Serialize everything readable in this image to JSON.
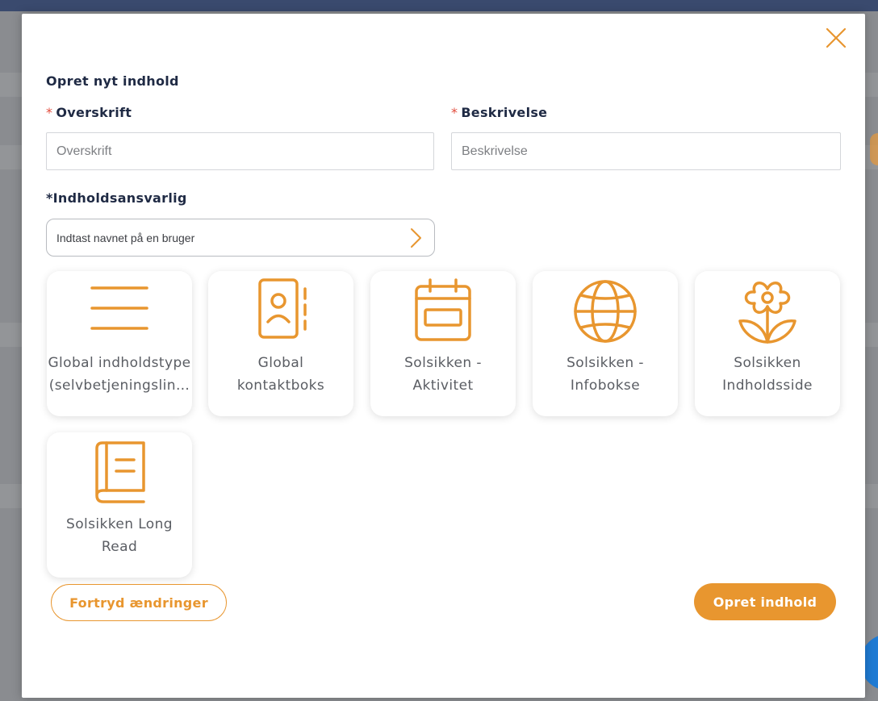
{
  "theme": {
    "accent": "#E8962F",
    "required": "#E24C3D",
    "text": "#1F2A44",
    "tile_text": "#5A5D63"
  },
  "modal": {
    "title": "Opret nyt indhold",
    "close_icon": "close-icon"
  },
  "fields": {
    "heading": {
      "label": "Overskrift",
      "required_marker": "*",
      "value": "",
      "placeholder": "Overskrift"
    },
    "description": {
      "label": "Beskrivelse",
      "required_marker": "*",
      "value": "",
      "placeholder": "Beskrivelse"
    },
    "owner": {
      "label": "*Indholdsansvarlig",
      "value": "",
      "placeholder": "Indtast navnet på en bruger",
      "icon": "chevron-right-icon"
    }
  },
  "content_types": [
    {
      "label": "Global indholdstype\n(selvbetjeningslin…",
      "icon": "menu-lines-icon"
    },
    {
      "label": "Global\nkontaktboks",
      "icon": "contact-book-icon"
    },
    {
      "label": "Solsikken -\nAktivitet",
      "icon": "calendar-icon"
    },
    {
      "label": "Solsikken -\nInfobokse",
      "icon": "globe-icon"
    },
    {
      "label": "Solsikken\nIndholdsside",
      "icon": "flower-icon"
    },
    {
      "label": "Solsikken Long\nRead",
      "icon": "book-icon"
    }
  ],
  "actions": {
    "cancel_label": "Fortryd ændringer",
    "create_label": "Opret indhold"
  }
}
